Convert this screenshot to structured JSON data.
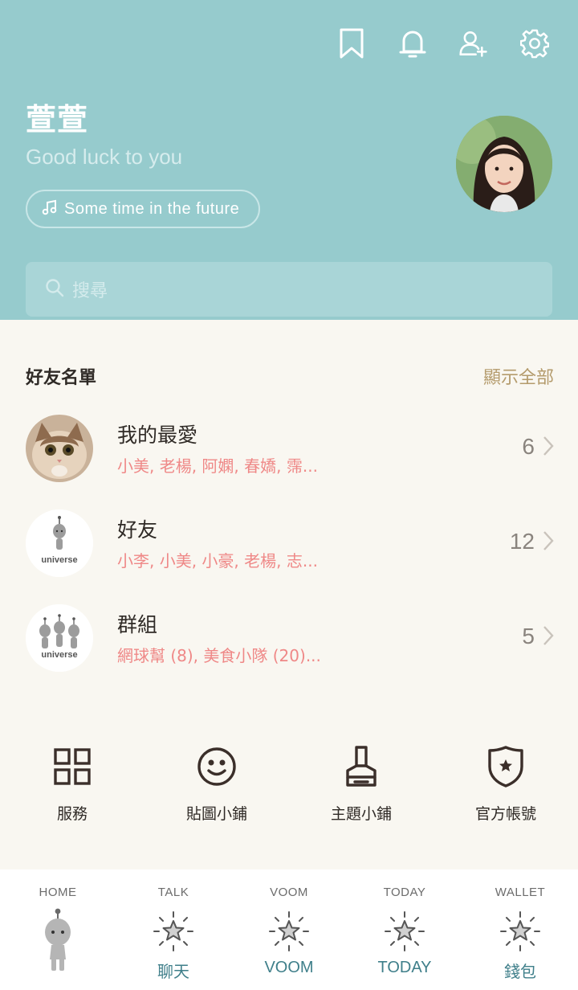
{
  "header": {
    "icons": [
      "bookmark-icon",
      "bell-icon",
      "add-friend-icon",
      "gear-icon"
    ],
    "name": "萱萱",
    "status": "Good luck to you",
    "music": "Some time in the future",
    "search_placeholder": "搜尋"
  },
  "friends_section": {
    "title": "好友名單",
    "show_all": "顯示全部",
    "rows": [
      {
        "title": "我的最愛",
        "members": "小美, 老楊, 阿嫻, 春嬌, 霈...",
        "count": "6"
      },
      {
        "title": "好友",
        "members": "小李, 小美, 小豪, 老楊, 志...",
        "count": "12"
      },
      {
        "title": "群組",
        "members": "網球幫 (8), 美食小隊 (20)...",
        "count": "5"
      }
    ],
    "universe_label": "universe"
  },
  "services": [
    {
      "label": "服務",
      "icon": "grid-icon"
    },
    {
      "label": "貼圖小鋪",
      "icon": "smiley-icon"
    },
    {
      "label": "主題小鋪",
      "icon": "brush-icon"
    },
    {
      "label": "官方帳號",
      "icon": "shield-star-icon"
    }
  ],
  "bottom_nav": [
    {
      "top": "HOME",
      "label": "",
      "icon": "alien-icon"
    },
    {
      "top": "TALK",
      "label": "聊天",
      "icon": "star-icon"
    },
    {
      "top": "VOOM",
      "label": "VOOM",
      "icon": "star-icon"
    },
    {
      "top": "TODAY",
      "label": "TODAY",
      "icon": "star-icon"
    },
    {
      "top": "WALLET",
      "label": "錢包",
      "icon": "star-icon"
    }
  ],
  "colors": {
    "header_bg": "#96cbcd",
    "body_bg": "#f9f7f1",
    "accent_pink": "#ef8887",
    "accent_gold": "#b49b6c",
    "nav_label": "#3f7f8a"
  }
}
